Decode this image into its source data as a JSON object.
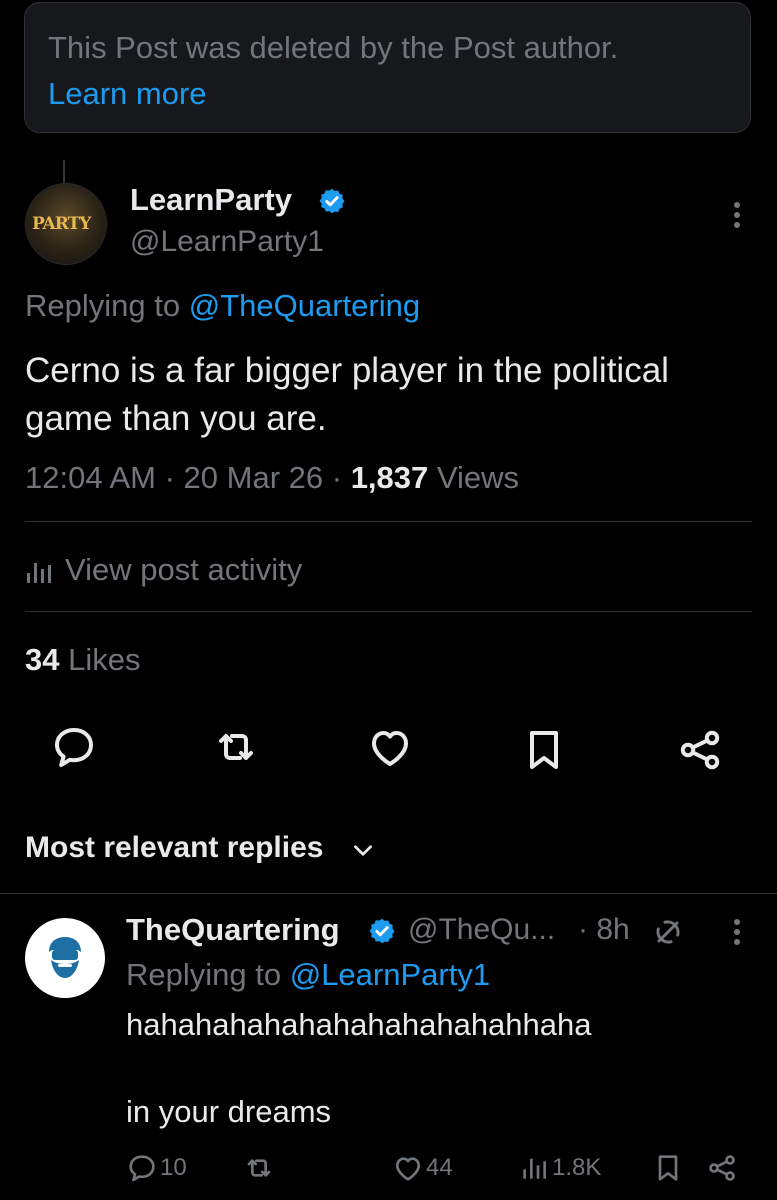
{
  "deleted_notice": {
    "text": "This Post was deleted by the Post author.",
    "link": "Learn more"
  },
  "post": {
    "avatar_label": "PARTY",
    "author_name": "LearnParty",
    "handle": "@LearnParty1",
    "replying_prefix": "Replying to ",
    "replying_to": "@TheQuartering",
    "text": "Cerno is a far bigger player in the political game than you are.",
    "time": "12:04 AM",
    "date": "20 Mar 26",
    "sep": " · ",
    "views_count": "1,837",
    "views_label": " Views",
    "view_activity": "View post activity",
    "likes_count": "34",
    "likes_label": " Likes"
  },
  "actions": {
    "icons": [
      "comment-icon",
      "retweet-icon",
      "heart-icon",
      "bookmark-icon",
      "share-icon"
    ]
  },
  "replies_section": {
    "title": "Most relevant replies"
  },
  "reply": {
    "author_name": "TheQuartering",
    "handle": "@TheQu...",
    "time": "· 8h",
    "replying_prefix": "Replying to ",
    "replying_to": "@LearnParty1",
    "line1": "hahahahahahahahahahahahhaha",
    "line2": "in your dreams",
    "reply_count": "10",
    "like_count": "44",
    "view_count": "1.8K"
  },
  "colors": {
    "background": "#000000",
    "text": "#e7e9ea",
    "muted": "#71767b",
    "accent": "#1d9bf0",
    "verified": "#1d9bf0"
  }
}
